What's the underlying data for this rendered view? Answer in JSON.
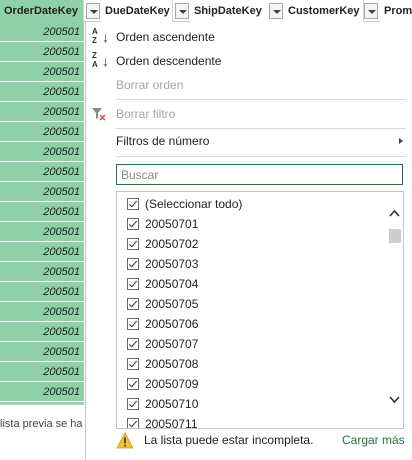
{
  "columns": {
    "order_date_key": "OrderDateKey",
    "due_date_key": "DueDateKey",
    "ship_date_key": "ShipDateKey",
    "customer_key": "CustomerKey",
    "partial": "Prom"
  },
  "data_cells": [
    "200501",
    "200501",
    "200501",
    "200501",
    "200501",
    "200501",
    "200501",
    "200501",
    "200501",
    "200501",
    "200501",
    "200501",
    "200501",
    "200501",
    "200501",
    "200501",
    "200501",
    "200501",
    "200501"
  ],
  "preview_note": "lista previa se ha",
  "menu": {
    "sort_asc": "Orden ascendente",
    "sort_desc": "Orden descendente",
    "clear_sort": "Borrar orden",
    "clear_filter": "Borrar filtro",
    "number_filters": "Filtros de número",
    "search_placeholder": "Buscar",
    "items": [
      "(Seleccionar todo)",
      "20050701",
      "20050702",
      "20050703",
      "20050704",
      "20050705",
      "20050706",
      "20050707",
      "20050708",
      "20050709",
      "20050710",
      "20050711"
    ],
    "warning": "La lista puede estar incompleta.",
    "load_more": "Cargar más"
  },
  "colors": {
    "selected_column": "#8fd0a9",
    "accent": "#217346"
  },
  "icons": [
    "filter-dropdown-icon",
    "sort-ascending-icon",
    "sort-descending-icon",
    "clear-filter-icon",
    "submenu-arrow-icon",
    "checkbox-icon",
    "scroll-up-icon",
    "scroll-down-icon",
    "warning-icon"
  ]
}
